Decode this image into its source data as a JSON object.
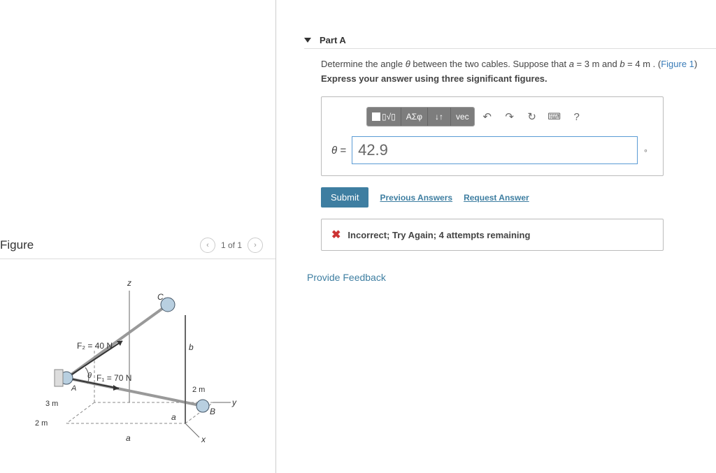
{
  "figure": {
    "title": "Figure",
    "pager": "1 of 1",
    "labels": {
      "z": "z",
      "x": "x",
      "y": "y",
      "C": "C",
      "A": "A",
      "B": "B",
      "b": "b",
      "a1": "a",
      "a2": "a",
      "F1": "F₁ = 70 N",
      "F2": "F₂ = 40 N",
      "d2m_a": "2 m",
      "d2m_b": "2 m",
      "d3m": "3 m",
      "theta": "θ"
    }
  },
  "part": {
    "label": "Part A",
    "prompt_pre": "Determine the angle ",
    "prompt_var": "θ",
    "prompt_mid": " between the two cables. Suppose that ",
    "prompt_a": "a",
    "prompt_aval": " = 3  m and ",
    "prompt_b": "b",
    "prompt_bval": " = 4  m . (",
    "fig_link": "Figure 1",
    "prompt_end": ")",
    "instruction": "Express your answer using three significant figures.",
    "toolbar": {
      "templates": "▯√▯",
      "greek": "ΑΣφ",
      "arrows": "↓↑",
      "vec": "vec",
      "undo": "↶",
      "redo": "↷",
      "reset": "↻",
      "keyboard": "⌨",
      "help": "?"
    },
    "theta_eq": "θ = ",
    "answer_value": "42.9",
    "unit": "∘",
    "submit": "Submit",
    "prev": "Previous Answers",
    "req": "Request Answer",
    "feedback": "Incorrect; Try Again; 4 attempts remaining"
  },
  "provide_feedback": "Provide Feedback"
}
